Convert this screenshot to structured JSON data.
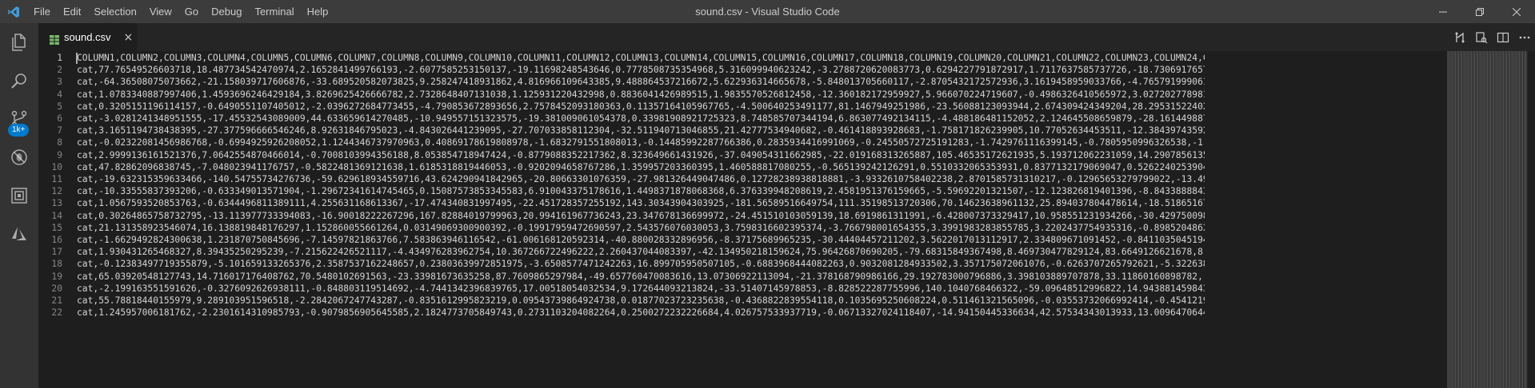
{
  "window": {
    "title": "sound.csv - Visual Studio Code",
    "menu": [
      "File",
      "Edit",
      "Selection",
      "View",
      "Go",
      "Debug",
      "Terminal",
      "Help"
    ]
  },
  "activity_bar": {
    "items": [
      "explorer-icon",
      "search-icon",
      "source-control-icon",
      "debug-icon",
      "extensions-icon",
      "azure-icon"
    ],
    "extensions_badge": "1k+"
  },
  "tab": {
    "label": "sound.csv",
    "close": "×"
  },
  "colors": {
    "titlebar": "#3c3c3c",
    "activitybar": "#333333",
    "tabbar": "#252526",
    "editor_bg": "#1e1e1e",
    "accent": "#007acc",
    "tab_icon": "#79b86c"
  },
  "editor": {
    "line_numbers": [
      "1",
      "2",
      "3",
      "4",
      "5",
      "6",
      "7",
      "8",
      "9",
      "10",
      "11",
      "12",
      "13",
      "14",
      "15",
      "16",
      "17",
      "18",
      "19",
      "20",
      "21",
      "22"
    ],
    "lines": [
      "COLUMN1,COLUMN2,COLUMN3,COLUMN4,COLUMN5,COLUMN6,COLUMN7,COLUMN8,COLUMN9,COLUMN10,COLUMN11,COLUMN12,COLUMN13,COLUMN14,COLUMN15,COLUMN16,COLUMN17,COLUMN18,COLUMN19,COLUMN20,COLUMN21,COLUMN22,COLUMN23,COLUMN24,COLUMN25,C",
      "cat,77.76549526603718,18.487734542470974,2.1652841499766193,-2.6077585253150137,-19.11698248543646,0.7778508735354968,5.316099940623242,-3.2788720620083773,0.6294227791872917,1.7117637585737726,-18.73069176574802,4.71",
      "cat,-64.36508075073662,-21.158039717606876,-33.689520582073825,9.258247418931862,4.816966109643385,9.488864537216672,5.622936314665678,-5.848013705660117,-2.8705432172572936,3.1619458959033766,-4.7657919990618565,2.31",
      "cat,1.0783340887997406,1.4593696246429184,3.8269625426666782,2.7328648407131038,1.125931220432998,0.8836041426989515,1.9835570526812458,-12.360182172959927,5.966070224719607,-0.4986326410565972,3.0272027789812,1.6971",
      "cat,0.3205151196114157,-0.6490551107405012,-2.0396272684773455,-4.790853672893656,2.7578452093180363,0.11357164105967765,-4.500640253491177,81.1467949251986,-23.56088123093944,2.674309424349204,28.29531522402579,20.",
      "cat,-3.0281241348951555,-17.45532543089009,44.633659614270485,-10.949557151323575,-19.381009061054378,0.33981908921725323,8.748585707344194,6.863077492134115,-4.488186481152052,2.124645508659879,-28.161449887878604,1.",
      "cat,3.1651194738438395,-27.377596666546246,8.92631846795023,-4.843026441239095,-27.707033858112304,-32.511940713046855,21.42777534940682,-0.461418893928683,-1.758171826239905,10.77052634453511,-12.384397435921692,-6.",
      "cat,-0.02322081456986768,-0.6994925926208052,1.1244346737970963,0.40869178619808978,-1.6832791551808013,-0.14485992287766386,0.2835934416991069,-0.24550572725191283,-1.7429761116399145,-0.7805950996326538,-1.5570403926",
      "cat,2.9999136161521376,7.0642554870466014,-0.7008103994356188,8.053854718947424,-0.8779088352217362,8.323649661431926,-37.049054311662985,-22.019168313265887,105.46535172621935,5.193712062231059,14.290785613587282,-5.",
      "cat,47.82862096838745,-7.048023941176757,-0.5822481369121638,1.6185318819446053,-0.9202094658767286,1.359957203360395,1.460588817080255,-0.565139242126291,0.5510332065353931,0.8377132179069047,0.5262240253904573,-0.74",
      "cat,-19.632315359633466,-140.54755734276736,-59.629618934559716,43.624290941842965,-20.80663301076359,-27.981326449047486,0.12728238938818881,-3.9332610758402238,2.8701585731310217,-0.12965653279799022,-13.499399638470",
      "cat,-10.33555837393206,-0.633349013571904,-1.29672341614745465,0.15087573853345583,6.910043375178616,1.4498371878068368,6.376339948208619,2.4581951376159665,-5.59692201321507,-12.123826819401396,-8.843388884398875,9.50",
      "cat,1.0567593520853763,-0.6344496811389111,4.255631168613367,-17.474340831997495,-22.451728357255192,143.30343904303925,-181.56589516649754,111.35198513720306,70.14623638961132,25.894037804478614,-18.518651676266263,9",
      "cat,0.30264865758732795,-13.113977733394083,-16.90018222267296,167.82884019799963,20.994161967736243,23.347678136699972,-24.451510103059139,18.6919861311991,-6.428007373329417,10.958551231934266,-30.429750098391946,23.",
      "cat,21.131358923546074,16.138819848176297,1.152860055661264,0.03149069300900392,-0.19917959472690597,2.543576076030053,3.7598316602395374,-3.766798001654355,3.3991983283855785,3.2202437754935316,-0.8985204862504925,2.6",
      "cat,-1.6629492824300638,1.231870750845696,-7.14597821863766,7.583863946116542,-61.006168120592314,-40.880028332896956,-8.37175689965235,-30.44404457211202,3.5622017013112917,2.334809671091452,-0.8411035045194322,13.91",
      "cat,1.930431265468327,8.39435250295239,-7.215622426521117,-4.434976283962754,10.367266722496222,2.260437044083397,-42.134950218159624,75.96426870690205,-79.68315849367498,8.469730477829124,83.6649126621678,8.895895937",
      "cat,-0.12383497719355879,-5.101659133265376,2.3587537162248657,0.23803639972851975,-3.6508577471242263,16.899705950507105,-0.6883968444082263,0.9032081284933502,3.357175072061076,-0.6263707265792621,-5.32263887963716,",
      "cat,65.03920548127743,14.716017176408762,70.5480102691563,-23.33981673635258,87.7609865297984,-49.657760470083616,13.07306922113094,-21.378168790986166,29.192783000796886,3.398103889707878,33.11860160898782,-31.69150",
      "cat,-2.199163551591626,-0.3276092626938111,-0.848803119514692,-4.7441342396839765,17.00518054032534,9.172644093213824,-33.51407145978853,-8.828522287755996,140.1040768466322,-59.09648512996822,14.943881459843857,-23.",
      "cat,55.78818440155979,9.289103951596518,-2.2842067247743287,-0.8351612995823219,0.09543739864924738,0.01877023723235638,-0.4368822839554118,0.1035695250608224,0.511461321565096,-0.03553732066992414,-0.454121996402113",
      "cat,1.245957006181762,-2.2301614310985793,-0.9079856905645585,2.1824773705849743,0.2731103204082264,0.2500272232226684,4.026757533937719,-0.06713327024118407,-14.94150445336634,42.57534343013933,13.009647064472931,-1."
    ]
  }
}
